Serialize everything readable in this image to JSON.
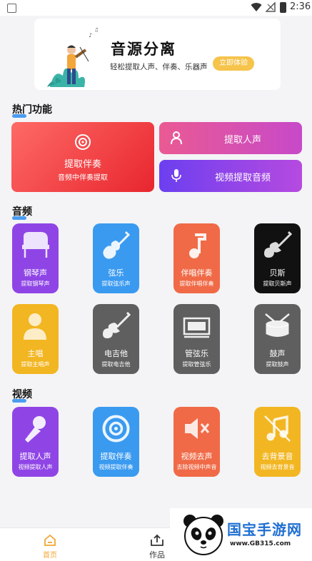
{
  "status_bar": {
    "time": "2:36"
  },
  "banner": {
    "title": "音源分离",
    "subtitle": "轻松提取人声、伴奏、乐器声",
    "cta": "立即体验"
  },
  "sections": {
    "hot": "热门功能",
    "audio": "音频",
    "video": "视频"
  },
  "hot_cards": {
    "extract_accompaniment": {
      "label": "提取伴奏",
      "sub": "音频中伴奏提取"
    },
    "extract_vocals": {
      "label": "提取人声"
    },
    "extract_video_audio": {
      "label": "视频提取音频"
    }
  },
  "audio_tiles": [
    {
      "label": "钢琴声",
      "sub": "提取钢琴声",
      "color": "#8f45e6"
    },
    {
      "label": "弦乐",
      "sub": "提取弦乐声",
      "color": "#3a9af0"
    },
    {
      "label": "伴唱伴奏",
      "sub": "提取伴唱伴奏",
      "color": "#f06a47"
    },
    {
      "label": "贝斯",
      "sub": "提取贝斯声",
      "color": "#111111"
    },
    {
      "label": "主唱",
      "sub": "提取主唱声",
      "color": "#f2b622"
    },
    {
      "label": "电吉他",
      "sub": "提取电吉他",
      "color": "#5f5f5f"
    },
    {
      "label": "管弦乐",
      "sub": "提取管弦乐",
      "color": "#5f5f5f"
    },
    {
      "label": "鼓声",
      "sub": "提取鼓声",
      "color": "#5f5f5f"
    }
  ],
  "video_tiles": [
    {
      "label": "提取人声",
      "sub": "视频提取人声",
      "color": "#8f45e6"
    },
    {
      "label": "提取伴奏",
      "sub": "视频提取伴奏",
      "color": "#3a9af0"
    },
    {
      "label": "视频去声",
      "sub": "去除视频中声音",
      "color": "#f06a47"
    },
    {
      "label": "去背景音",
      "sub": "视频去背景音",
      "color": "#f2b622"
    }
  ],
  "bottom_nav": {
    "home": "首页",
    "works": "作品"
  },
  "watermark": {
    "text": "国宝手游网",
    "url": "www.GB315.com"
  }
}
